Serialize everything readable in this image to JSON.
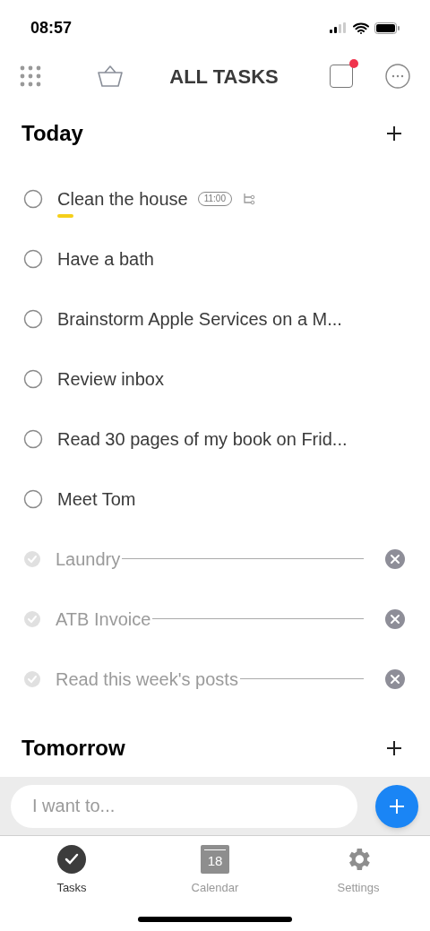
{
  "status_bar": {
    "time": "08:57"
  },
  "header": {
    "title": "ALL TASKS",
    "notification": true
  },
  "sections": [
    {
      "title": "Today",
      "tasks": [
        {
          "title": "Clean the house",
          "done": false,
          "time": "11:00",
          "subtasks": true,
          "marked": true
        },
        {
          "title": "Have a bath",
          "done": false,
          "subtasks": false,
          "marked": false
        },
        {
          "title": "Brainstorm Apple Services on a M...",
          "done": false,
          "subtasks": false,
          "marked": false
        },
        {
          "title": "Review inbox",
          "done": false,
          "subtasks": false,
          "marked": false
        },
        {
          "title": "Read 30 pages of my book on Frid...",
          "done": false,
          "subtasks": false,
          "marked": false
        },
        {
          "title": "Meet Tom",
          "done": false,
          "subtasks": false,
          "marked": false
        },
        {
          "title": "Laundry",
          "done": true,
          "subtasks": false,
          "marked": false
        },
        {
          "title": "ATB Invoice",
          "done": true,
          "subtasks": false,
          "marked": false
        },
        {
          "title": "Read this week's posts",
          "done": true,
          "subtasks": false,
          "marked": false
        }
      ]
    },
    {
      "title": "Tomorrow"
    }
  ],
  "composer": {
    "placeholder": "I want to..."
  },
  "tabs": [
    {
      "kind": "tasks",
      "label": "Tasks",
      "selected": true
    },
    {
      "kind": "calendar",
      "label": "Calendar",
      "selected": false,
      "day": "18"
    },
    {
      "kind": "settings",
      "label": "Settings",
      "selected": false
    }
  ]
}
